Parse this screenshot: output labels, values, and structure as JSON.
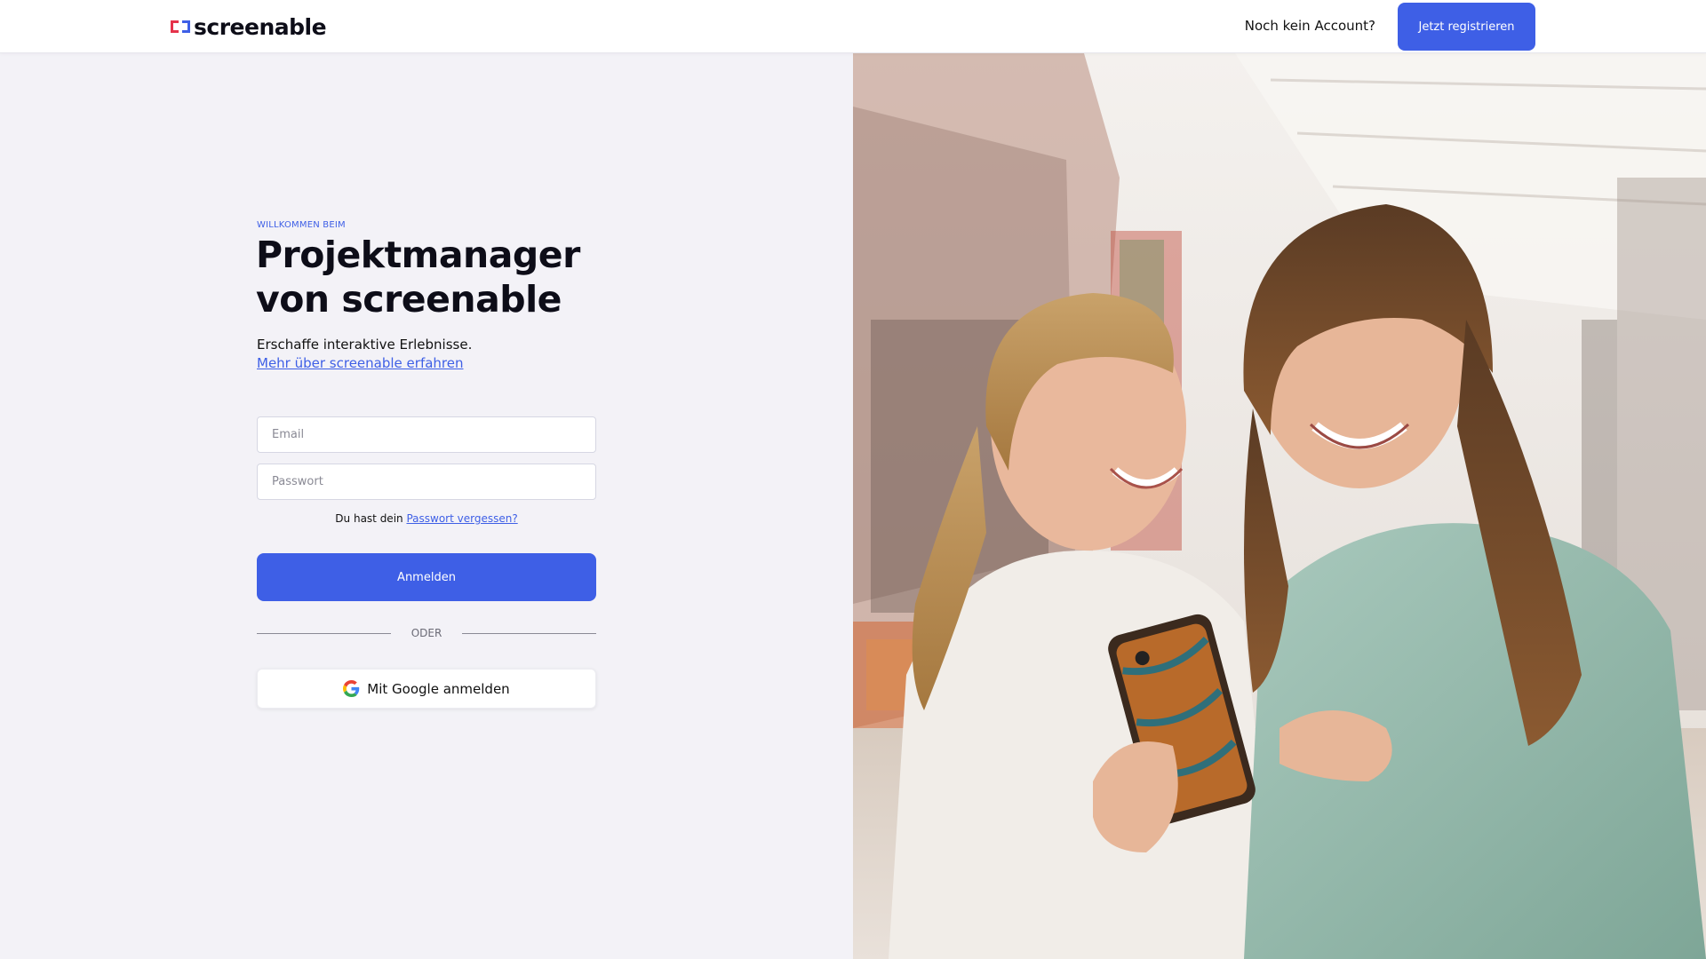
{
  "header": {
    "logo_text": "screenable",
    "no_account_text": "Noch kein Account?",
    "register_label": "Jetzt registrieren"
  },
  "login": {
    "eyebrow": "WILLKOMMEN BEIM",
    "headline_line1": "Projektmanager",
    "headline_line2": "von screenable",
    "subline": "Erschaffe interaktive Erlebnisse.",
    "learn_more": "Mehr über screenable erfahren",
    "email_placeholder": "Email",
    "password_placeholder": "Passwort",
    "forgot_prefix": "Du hast dein",
    "forgot_link": "Passwort vergessen?",
    "login_label": "Anmelden",
    "divider_text": "ODER",
    "google_label": "Mit Google anmelden"
  },
  "colors": {
    "accent": "#3e5fe6",
    "background": "#f3f2f7",
    "logo_red": "#e5334b",
    "logo_blue": "#3e5fe6"
  },
  "icons": {
    "logo": "screenable-logo-mark",
    "google": "google-g-icon"
  },
  "hero_image": {
    "description": "Two smiling young women looking at a smartphone in a shopping arcade"
  }
}
